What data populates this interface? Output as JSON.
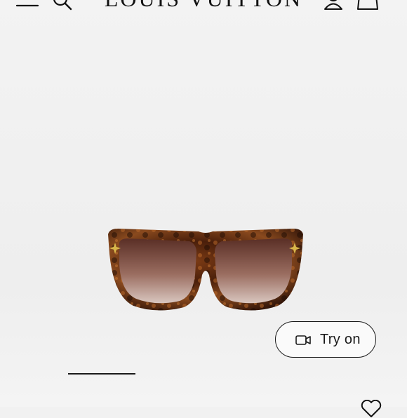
{
  "header": {
    "brand": "LOUIS VUITTON",
    "icons": [
      "menu-icon",
      "search-icon",
      "account-icon",
      "shopping-bag-icon"
    ]
  },
  "product": {
    "image": "tortoiseshell-square-sunglasses-with-brown-gradient-lenses"
  },
  "try_on": {
    "label": "Try on",
    "icon": "video-camera-icon"
  },
  "carousel": {
    "active_index": 1
  },
  "footer_icons": [
    "wishlist-heart-icon"
  ]
}
